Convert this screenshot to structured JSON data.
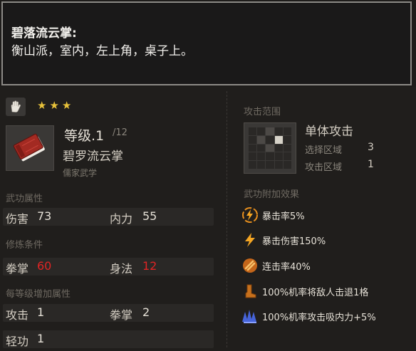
{
  "tooltip": {
    "title": "碧落流云掌:",
    "body": "衡山派，室内，左上角，桌子上。"
  },
  "skill": {
    "stars": [
      "★",
      "★",
      "★"
    ],
    "level": "等级.1",
    "level_max": "/12",
    "name": "碧罗流云掌",
    "school": "儒家武学"
  },
  "attributes": {
    "label": "武功属性",
    "damage_label": "伤害",
    "damage": "73",
    "mp_label": "内力",
    "mp": "55"
  },
  "requirements": {
    "label": "修炼条件",
    "palm_label": "拳掌",
    "palm": "60",
    "agility_label": "身法",
    "agility": "12"
  },
  "per_level": {
    "label": "每等级增加属性",
    "attack_label": "攻击",
    "attack": "1",
    "palm_label": "拳掌",
    "palm": "2",
    "lightness_label": "轻功",
    "lightness": "1"
  },
  "range": {
    "label": "攻击范围",
    "type": "单体攻击",
    "select_label": "选择区域",
    "select_value": "3",
    "attack_area_label": "攻击区域",
    "attack_area_value": "1"
  },
  "effects": {
    "label": "武功附加效果",
    "items": [
      {
        "text": "暴击率5%",
        "icon": "critical-rate-icon"
      },
      {
        "text": "暴击伤害150%",
        "icon": "lightning-icon"
      },
      {
        "text": "连击率40%",
        "icon": "combo-icon"
      },
      {
        "text": "100%机率将敌人击退1格",
        "icon": "boot-icon"
      },
      {
        "text": "100%机率攻击吸内力+5%",
        "icon": "absorb-icon"
      }
    ]
  },
  "colors": {
    "star": "#e8c23a",
    "unmet_requirement": "#e02424",
    "effect_icon_orange": "#e8901e",
    "effect_icon_blue": "#4a6cf0"
  }
}
